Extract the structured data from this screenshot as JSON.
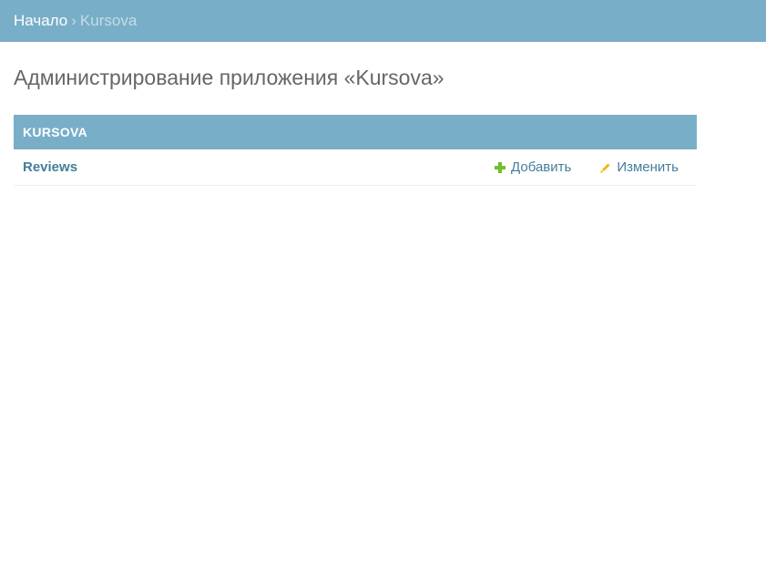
{
  "breadcrumbs": {
    "home": "Начало",
    "separator": "›",
    "current": "Kursova"
  },
  "page_title": "Администрирование приложения «Kursova»",
  "module": {
    "caption": "Kursova",
    "models": [
      {
        "name": "Reviews",
        "add_label": "Добавить",
        "change_label": "Изменить",
        "add_icon": "plus-icon",
        "change_icon": "pencil-icon"
      }
    ]
  },
  "colors": {
    "header_bg": "#79aec8",
    "link": "#447e9b",
    "add_icon": "#70bf2b",
    "change_icon": "#efb80b"
  }
}
